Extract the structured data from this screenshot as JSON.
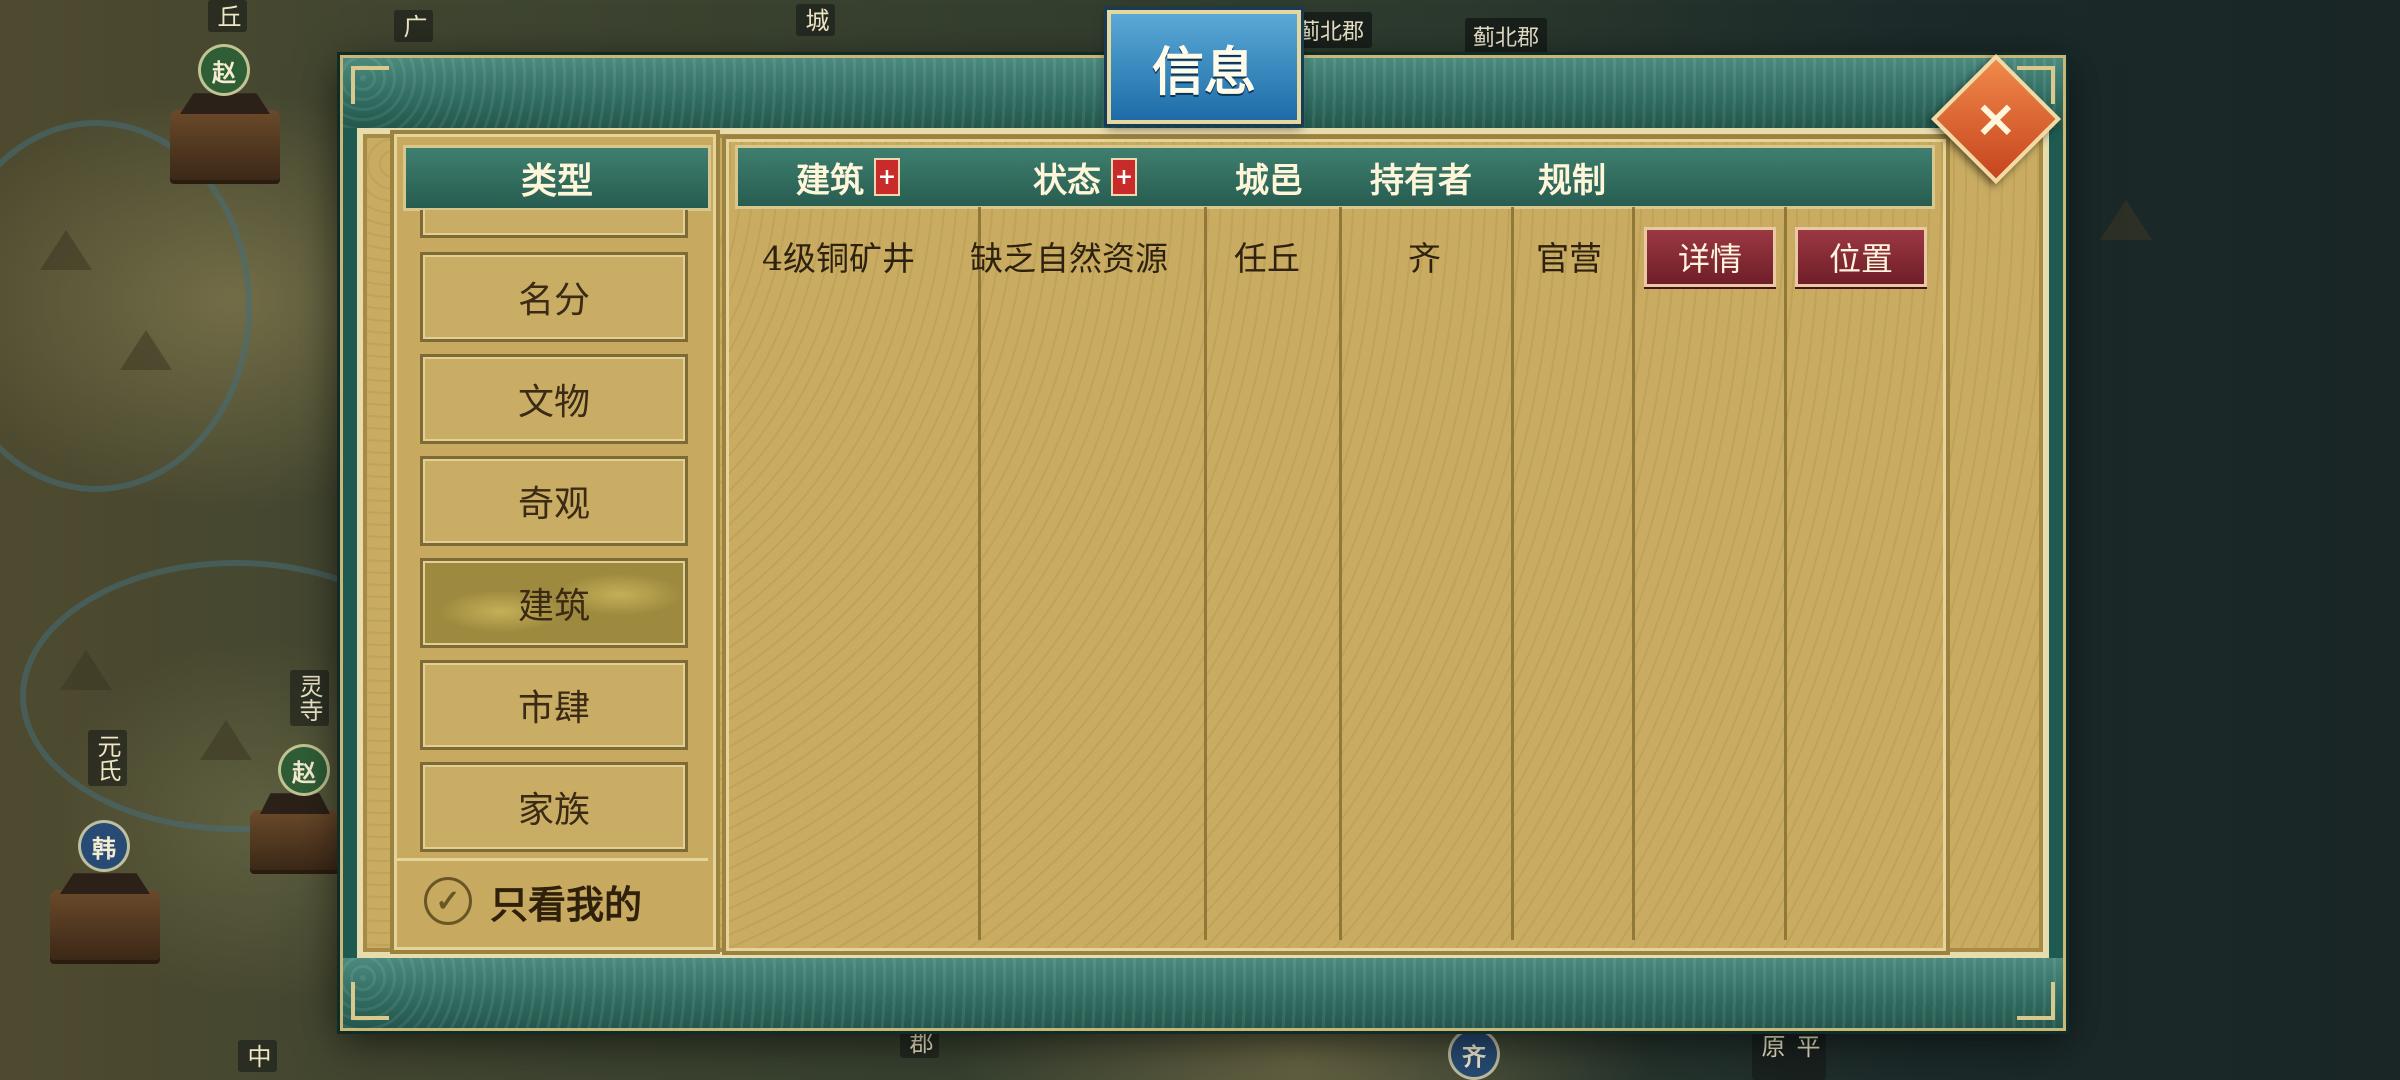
{
  "map": {
    "labels": [
      "蓟北郡",
      "蓟北郡"
    ],
    "vertical_labels": [
      "丘",
      "广",
      "城",
      "灵寺",
      "元氏",
      "郡",
      "平原",
      "中"
    ],
    "badges": [
      {
        "text": "赵",
        "color": "green"
      },
      {
        "text": "赵",
        "color": "green"
      },
      {
        "text": "韩",
        "color": "blue"
      },
      {
        "text": "齐",
        "color": "blue"
      }
    ]
  },
  "dialog": {
    "title": "信息",
    "close_icon": "×"
  },
  "categories": {
    "header": "类型",
    "items": [
      {
        "label": "名分",
        "active": false
      },
      {
        "label": "文物",
        "active": false
      },
      {
        "label": "奇观",
        "active": false
      },
      {
        "label": "建筑",
        "active": true
      },
      {
        "label": "市肆",
        "active": false
      },
      {
        "label": "家族",
        "active": false
      }
    ],
    "only_mine_label": "只看我的",
    "only_mine_checked": true,
    "check_icon": "✓"
  },
  "table": {
    "columns": [
      {
        "label": "建筑",
        "sortable": true
      },
      {
        "label": "状态",
        "sortable": true
      },
      {
        "label": "城邑",
        "sortable": false
      },
      {
        "label": "持有者",
        "sortable": false
      },
      {
        "label": "规制",
        "sortable": false
      }
    ],
    "sort_icon": "+",
    "rows": [
      {
        "building": "4级铜矿井",
        "status": "缺乏自然资源",
        "city": "任丘",
        "owner": "齐",
        "regime": "官营",
        "detail_button": "详情",
        "location_button": "位置"
      }
    ]
  },
  "colors": {
    "frame_green": "#2f6b60",
    "parchment": "#c9ac62",
    "title_blue": "#1d6ca8",
    "close_orange": "#e0622f",
    "button_red": "#8a2a34"
  }
}
